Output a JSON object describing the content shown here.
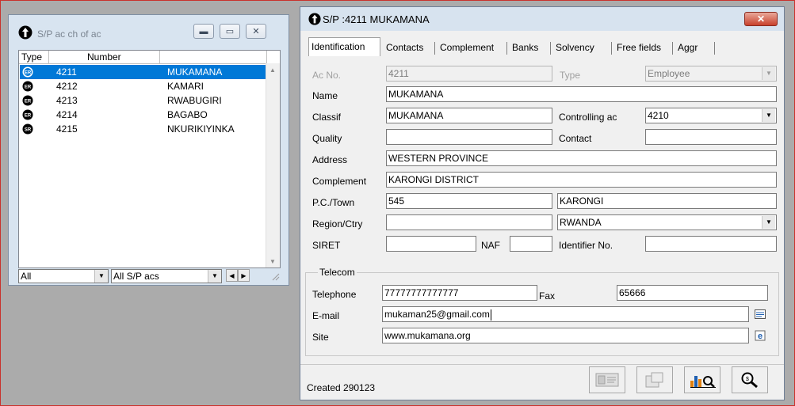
{
  "left_window": {
    "title": "S/P ac ch of ac",
    "columns": [
      "Type",
      "Number",
      ""
    ],
    "rows": [
      {
        "badge": "ER",
        "number": "4211",
        "name": "MUKAMANA",
        "selected": true
      },
      {
        "badge": "ER",
        "number": "4212",
        "name": "KAMARI",
        "selected": false
      },
      {
        "badge": "ER",
        "number": "4213",
        "name": "RWABUGIRI",
        "selected": false
      },
      {
        "badge": "ER",
        "number": "4214",
        "name": "BAGABO",
        "selected": false
      },
      {
        "badge": "SR",
        "number": "4215",
        "name": "NKURIKIYINKA",
        "selected": false
      }
    ],
    "filter_left": "All",
    "filter_right": "All S/P acs"
  },
  "right_window": {
    "title": "S/P :4211 MUKAMANA",
    "tabs": [
      "Identification",
      "Contacts",
      "Complement",
      "Banks",
      "Solvency",
      "Free fields",
      "Aggr"
    ],
    "active_tab": "Identification",
    "form": {
      "ac_no_label": "Ac No.",
      "ac_no": "4211",
      "type_label": "Type",
      "type": "Employee",
      "name_label": "Name",
      "name": "MUKAMANA",
      "classif_label": "Classif",
      "classif": "MUKAMANA",
      "controlling_label": "Controlling ac",
      "controlling": "4210",
      "quality_label": "Quality",
      "quality": "",
      "contact_label": "Contact",
      "contact": "",
      "address_label": "Address",
      "address": "WESTERN PROVINCE",
      "complement_label": "Complement",
      "complement": "KARONGI DISTRICT",
      "pc_town_label": "P.C./Town",
      "pc": "545",
      "town": "KARONGI",
      "region_label": "Region/Ctry",
      "region": "",
      "country": "RWANDA",
      "siret_label": "SIRET",
      "siret": "",
      "naf_label": "NAF",
      "naf": "",
      "identifier_label": "Identifier No.",
      "identifier": ""
    },
    "telecom": {
      "legend": "Telecom",
      "telephone_label": "Telephone",
      "telephone": "77777777777777",
      "fax_label": "Fax",
      "fax": "65666",
      "email_label": "E-mail",
      "email": "mukaman25@gmail.com",
      "site_label": "Site",
      "site": "www.mukamana.org"
    },
    "status": "Created 290123"
  }
}
